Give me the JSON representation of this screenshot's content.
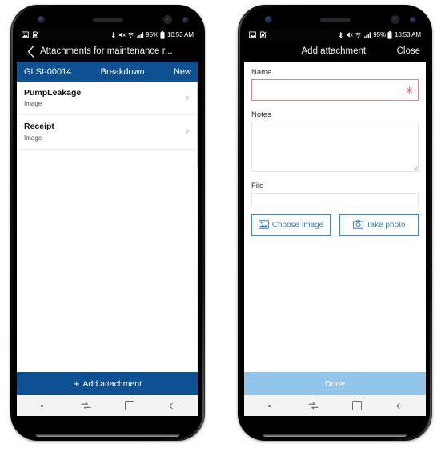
{
  "status_bar": {
    "time": "10:53 AM",
    "battery_percent": "95%",
    "icons_left": [
      "image-icon",
      "sim-card-off-icon"
    ],
    "icons_right": [
      "bluetooth-icon",
      "mute-icon",
      "wifi-icon",
      "signal-icon",
      "battery-icon"
    ]
  },
  "left_phone": {
    "title": "Attachments for maintenance r...",
    "back_icon": "back-chevron-icon",
    "record_header": {
      "id": "GLSI-00014",
      "type": "Breakdown",
      "status": "New"
    },
    "attachments": [
      {
        "name": "PumpLeakage",
        "type": "Image"
      },
      {
        "name": "Receipt",
        "type": "Image"
      }
    ],
    "footer_button": "Add attachment",
    "footer_icon": "plus-icon"
  },
  "right_phone": {
    "title": "Add attachment",
    "close_label": "Close",
    "fields": {
      "name_label": "Name",
      "name_value": "",
      "name_required_marker": "✳",
      "notes_label": "Notes",
      "notes_value": "",
      "file_label": "File",
      "file_value": ""
    },
    "buttons": {
      "choose_image": "Choose image",
      "choose_image_icon": "image-picture-icon",
      "take_photo": "Take photo",
      "take_photo_icon": "camera-icon"
    },
    "footer_button": "Done"
  },
  "nav_bar": {
    "items": [
      "recents-dot-icon",
      "multitask-icon",
      "home-square-icon",
      "back-arrow-icon"
    ]
  },
  "colors": {
    "primary_blue": "#0d5193",
    "done_blue": "#92c5e9",
    "link_blue": "#2f7fc6",
    "required_red": "#e23a3a"
  }
}
